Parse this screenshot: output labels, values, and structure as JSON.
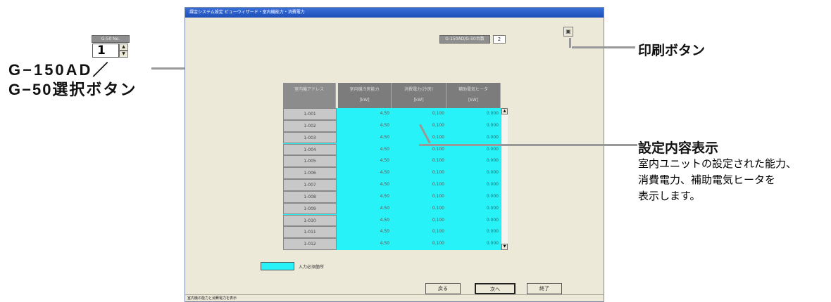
{
  "window": {
    "title": "課金システム設定 ビューウィザード・室内機能力・消費電力",
    "status": "室内機の能力と消費電力を表示"
  },
  "selector": {
    "label": "G-50 No.",
    "value": "1",
    "up": "▲",
    "down": "▼"
  },
  "count": {
    "label": "G-150AD/G-50台数",
    "value": "2"
  },
  "print": {
    "icon": "printer-icon"
  },
  "table": {
    "headers": [
      {
        "title": "室内機アドレス",
        "unit": ""
      },
      {
        "title": "室内機冷房能力",
        "unit": "[kW]"
      },
      {
        "title": "消費電力(冷房)",
        "unit": "[kW]"
      },
      {
        "title": "補助電気ヒータ",
        "unit": "[kW]"
      }
    ],
    "rows": [
      {
        "addr": "1-001",
        "cap": "4.50",
        "power": "0.100",
        "heater": "0.000"
      },
      {
        "addr": "1-002",
        "cap": "4.50",
        "power": "0.100",
        "heater": "0.000"
      },
      {
        "addr": "1-003",
        "cap": "4.50",
        "power": "0.100",
        "heater": "0.000"
      },
      {
        "addr": "1-004",
        "cap": "4.50",
        "power": "0.100",
        "heater": "0.000"
      },
      {
        "addr": "1-005",
        "cap": "4.50",
        "power": "0.100",
        "heater": "0.000"
      },
      {
        "addr": "1-006",
        "cap": "4.50",
        "power": "0.100",
        "heater": "0.000"
      },
      {
        "addr": "1-007",
        "cap": "4.50",
        "power": "0.100",
        "heater": "0.000"
      },
      {
        "addr": "1-008",
        "cap": "4.50",
        "power": "0.100",
        "heater": "0.000"
      },
      {
        "addr": "1-009",
        "cap": "4.50",
        "power": "0.100",
        "heater": "0.000"
      },
      {
        "addr": "1-010",
        "cap": "4.50",
        "power": "0.100",
        "heater": "0.000"
      },
      {
        "addr": "1-011",
        "cap": "4.50",
        "power": "0.100",
        "heater": "0.000"
      },
      {
        "addr": "1-012",
        "cap": "4.50",
        "power": "0.100",
        "heater": "0.000"
      }
    ]
  },
  "legend": {
    "text": "入力必須箇所"
  },
  "buttons": {
    "back": "戻る",
    "next": "次へ",
    "end": "終了"
  },
  "annotations": {
    "selector_line1": "G−150AD／",
    "selector_line2": "G−50選択ボタン",
    "print": "印刷ボタン",
    "content_title": "設定内容表示",
    "content_desc1": "室内ユニットの設定された能力、",
    "content_desc2": "消費電力、補助電気ヒータを",
    "content_desc3": "表示します。"
  },
  "colors": {
    "input_required": "#27f2f8",
    "title_bar": "#1d4fb8"
  }
}
